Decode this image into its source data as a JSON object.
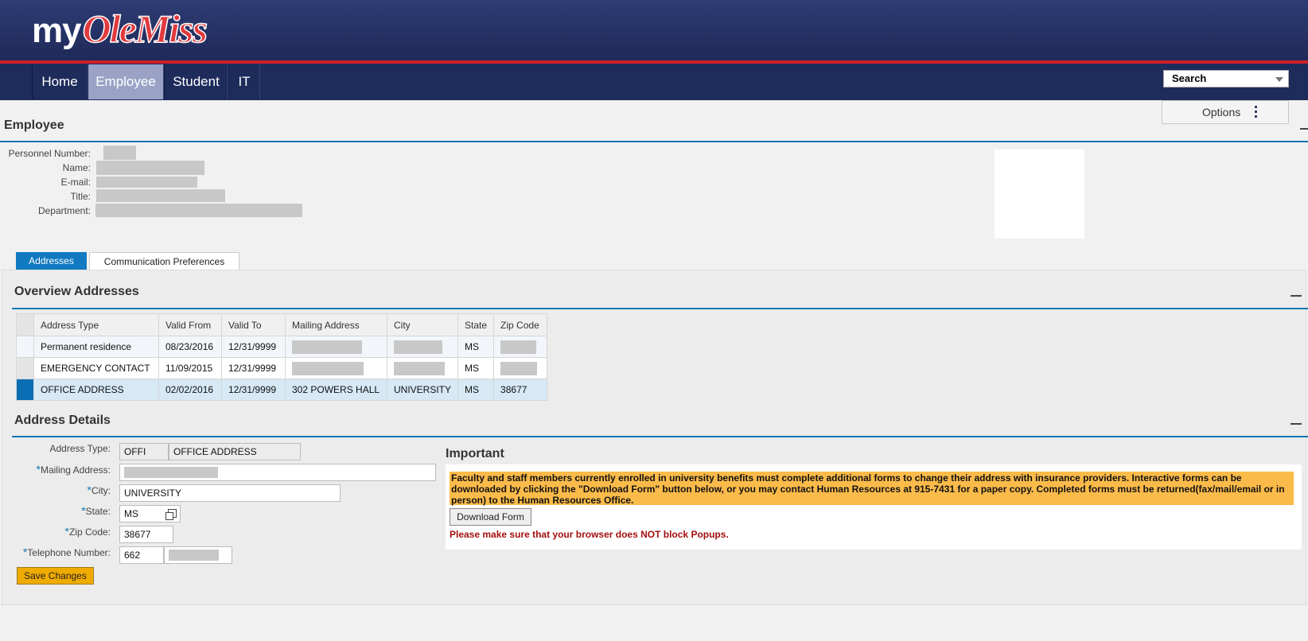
{
  "header": {
    "logo_my": "my",
    "logo_brand": "OleMiss",
    "nav": [
      {
        "label": "Home"
      },
      {
        "label": "Employee"
      },
      {
        "label": "Student"
      },
      {
        "label": "IT"
      }
    ],
    "search_label": "Search",
    "options_label": "Options"
  },
  "employee": {
    "title": "Employee",
    "labels": {
      "personnel_number": "Personnel Number:",
      "name": "Name:",
      "email": "E-mail:",
      "title": "Title:",
      "department": "Department:"
    }
  },
  "tabs": [
    {
      "label": "Addresses"
    },
    {
      "label": "Communication Preferences"
    }
  ],
  "overview": {
    "title": "Overview Addresses",
    "columns": [
      "Address Type",
      "Valid From",
      "Valid To",
      "Mailing Address",
      "City",
      "State",
      "Zip Code"
    ],
    "rows": [
      {
        "type": "Permanent residence",
        "from": "08/23/2016",
        "to": "12/31/9999",
        "mailing": "",
        "city": "",
        "state": "MS",
        "zip": ""
      },
      {
        "type": "EMERGENCY CONTACT",
        "from": "11/09/2015",
        "to": "12/31/9999",
        "mailing": "",
        "city": "",
        "state": "MS",
        "zip": ""
      },
      {
        "type": "OFFICE ADDRESS",
        "from": "02/02/2016",
        "to": "12/31/9999",
        "mailing": "302 POWERS HALL",
        "city": "UNIVERSITY",
        "state": "MS",
        "zip": "38677"
      }
    ]
  },
  "details": {
    "title": "Address Details",
    "labels": {
      "address_type": "Address Type:",
      "mailing": "Mailing Address:",
      "city": "City:",
      "state": "State:",
      "zip": "Zip Code:",
      "phone": "Telephone Number:"
    },
    "values": {
      "type_code": "OFFI",
      "type_name": "OFFICE ADDRESS",
      "city": "UNIVERSITY",
      "state": "MS",
      "zip": "38677",
      "phone_area": "662"
    },
    "save_label": "Save Changes"
  },
  "important": {
    "title": "Important",
    "message": "Faculty and staff members currently enrolled in university benefits must complete additional forms to change their address with insurance providers.  Interactive forms can be downloaded by clicking the \"Download Form\" button below, or you may contact Human Resources at 915-7431 for a paper copy. Completed forms must be returned(fax/mail/email or in person) to the Human Resources Office.",
    "download_label": "Download Form",
    "popup_warning": "Please make sure that your browser does NOT block Popups."
  }
}
